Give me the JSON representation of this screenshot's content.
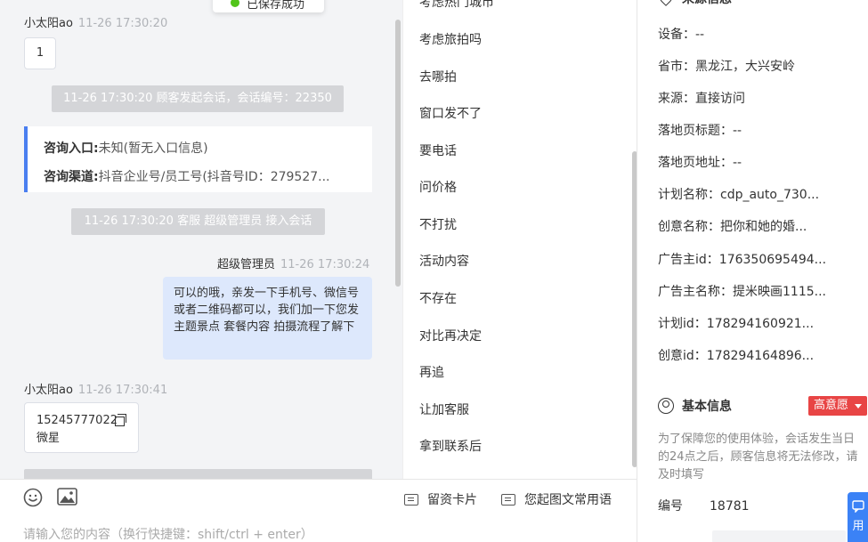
{
  "toast": {
    "text": "已保存成功"
  },
  "chat": {
    "msg1": {
      "sender": "小太阳ao",
      "time": "11-26 17:30:20",
      "text": "1"
    },
    "sys1": "11-26 17:30:20 顾客发起会话，会话编号：22350",
    "info_card": {
      "entry_label": "咨询入口:",
      "entry_value": "未知(暂无入口信息)",
      "channel_label": "咨询渠道:",
      "channel_value": "抖音企业号/员工号(抖音号ID：279527..."
    },
    "sys2": "11-26 17:30:20 客服 超级管理员 接入会话",
    "msg2": {
      "sender": "超级管理员",
      "time": "11-26 17:30:24",
      "text": "可以的哦，亲发一下手机号、微信号或者二维码都可以，我们加一下您发主题景点 套餐内容 拍摄流程了解下"
    },
    "msg3": {
      "sender": "小太阳ao",
      "time": "11-26 17:30:41",
      "line1": "15245777022",
      "line2": "微星"
    }
  },
  "toolbar": {
    "card_label": "留资卡片",
    "common_label": "您起图文常用语",
    "input_placeholder": "请输入您的内容（换行快捷键：shift/ctrl + enter）"
  },
  "phrases": [
    "考虑热门城市",
    "考虑旅拍吗",
    "去哪拍",
    "窗口发不了",
    "要电话",
    "问价格",
    "不打扰",
    "活动内容",
    "不存在",
    "对比再决定",
    "再追",
    "让加客服",
    "拿到联系后"
  ],
  "right": {
    "source_title": "来源信息",
    "fields": [
      {
        "label": "设备：",
        "value": "--"
      },
      {
        "label": "省市：",
        "value": "黑龙江，大兴安岭"
      },
      {
        "label": "来源：",
        "value": "直接访问"
      },
      {
        "label": "落地页标题：",
        "value": "--"
      },
      {
        "label": "落地页地址：",
        "value": "--"
      },
      {
        "label": "计划名称：",
        "value": "cdp_auto_730..."
      },
      {
        "label": "创意名称：",
        "value": "把你和她的婚..."
      },
      {
        "label": "广告主id：",
        "value": "176350695494..."
      },
      {
        "label": "广告主名称：",
        "value": "提米映画1115..."
      },
      {
        "label": "计划id：",
        "value": "178294160921..."
      },
      {
        "label": "创意id：",
        "value": "178294164896..."
      }
    ],
    "basic_title": "基本信息",
    "intent_badge": "高意愿",
    "notice": "为了保障您的使用体验，会话发生当日的24点之后，顾客信息将无法修改，请及时填写",
    "number_label": "编号",
    "number_value": "18781",
    "float_button": "用"
  }
}
